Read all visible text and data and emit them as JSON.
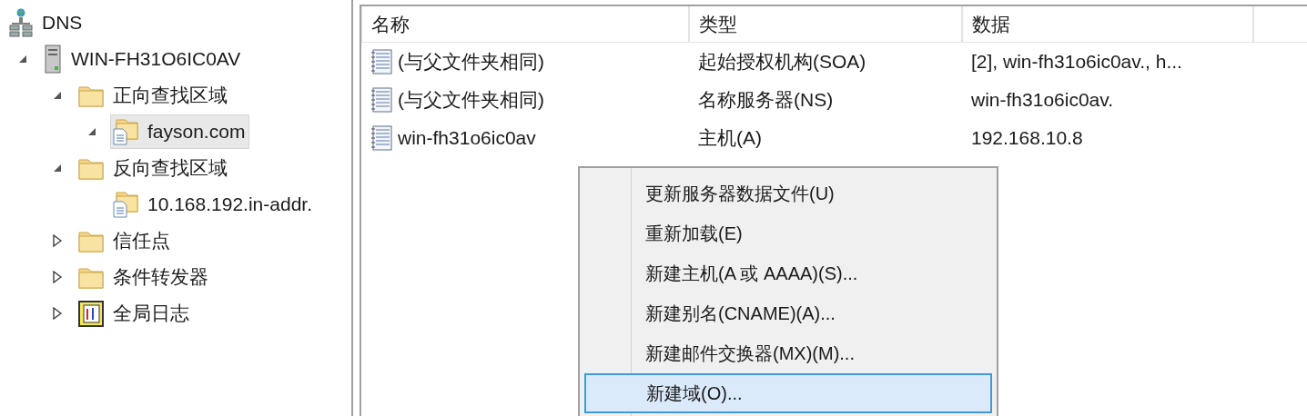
{
  "tree": [
    {
      "label": "DNS",
      "kind": "dns",
      "selected": false,
      "children": [
        {
          "label": "WIN-FH31O6IC0AV",
          "kind": "server",
          "expanded": true,
          "selected": false,
          "children": [
            {
              "label": "正向查找区域",
              "kind": "folder",
              "expanded": true,
              "selected": false,
              "children": [
                {
                  "label": "fayson.com",
                  "kind": "zone",
                  "expanded": true,
                  "selected": true
                }
              ]
            },
            {
              "label": "反向查找区域",
              "kind": "folder",
              "expanded": true,
              "selected": false,
              "children": [
                {
                  "label": "10.168.192.in-addr.",
                  "kind": "zone",
                  "selected": false
                }
              ]
            },
            {
              "label": "信任点",
              "kind": "folder",
              "expanded": false,
              "selected": false
            },
            {
              "label": "条件转发器",
              "kind": "folder",
              "expanded": false,
              "selected": false
            },
            {
              "label": "全局日志",
              "kind": "log",
              "expanded": false,
              "selected": false
            }
          ]
        }
      ]
    }
  ],
  "table": {
    "columns": [
      "名称",
      "类型",
      "数据"
    ],
    "rows": [
      {
        "name": "(与父文件夹相同)",
        "type": "起始授权机构(SOA)",
        "data": "[2], win-fh31o6ic0av., h..."
      },
      {
        "name": "(与父文件夹相同)",
        "type": "名称服务器(NS)",
        "data": "win-fh31o6ic0av."
      },
      {
        "name": "win-fh31o6ic0av",
        "type": "主机(A)",
        "data": "192.168.10.8"
      }
    ]
  },
  "context_menu": [
    {
      "label": "更新服务器数据文件(U)",
      "selected": false
    },
    {
      "label": "重新加载(E)",
      "selected": false
    },
    {
      "label": "新建主机(A 或 AAAA)(S)...",
      "selected": false
    },
    {
      "label": "新建别名(CNAME)(A)...",
      "selected": false
    },
    {
      "label": "新建邮件交换器(MX)(M)...",
      "selected": false
    },
    {
      "label": "新建域(O)...",
      "selected": true
    }
  ]
}
